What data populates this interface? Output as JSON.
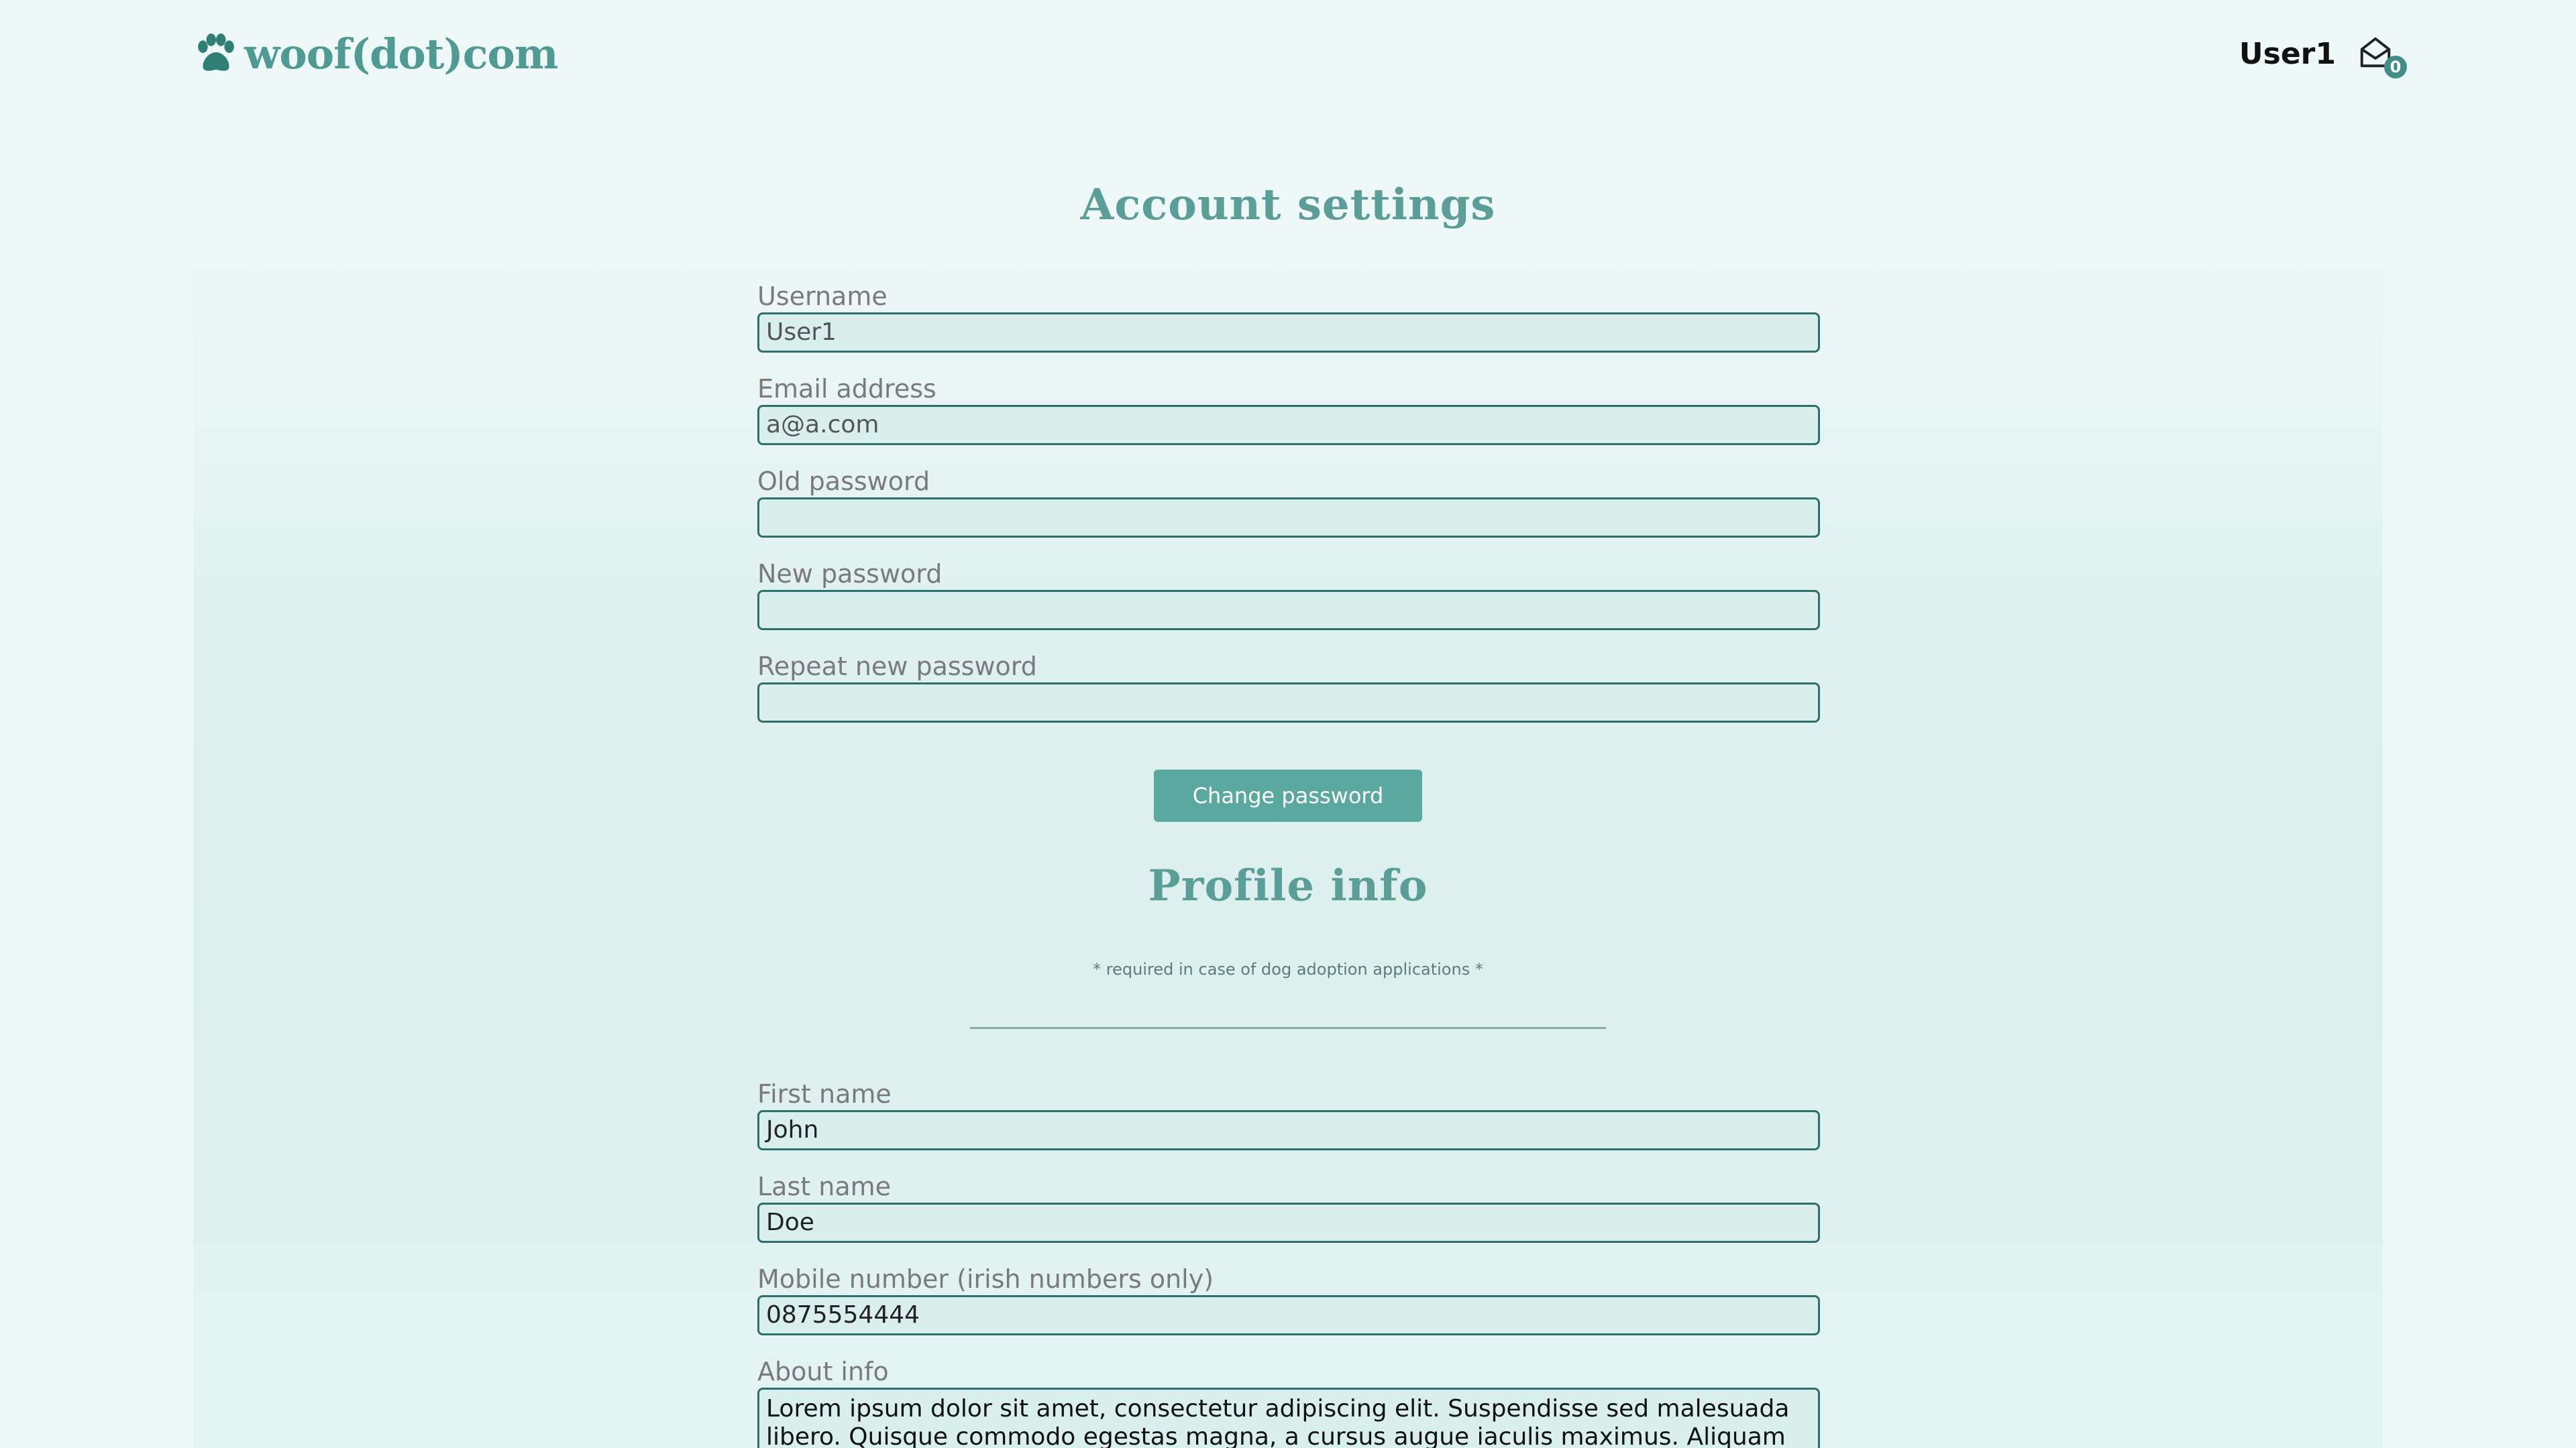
{
  "header": {
    "logo_text": "woof(dot)com",
    "username": "User1",
    "mail_count": "0"
  },
  "account": {
    "title": "Account settings",
    "username": {
      "label": "Username",
      "value": "User1"
    },
    "email": {
      "label": "Email address",
      "value": "a@a.com"
    },
    "old_password": {
      "label": "Old password",
      "value": ""
    },
    "new_password": {
      "label": "New password",
      "value": ""
    },
    "repeat_password": {
      "label": "Repeat new password",
      "value": ""
    },
    "change_password_label": "Change password"
  },
  "profile": {
    "title": "Profile info",
    "note": "* required in case of dog adoption applications *",
    "first_name": {
      "label": "First name",
      "value": "John"
    },
    "last_name": {
      "label": "Last name",
      "value": "Doe"
    },
    "mobile": {
      "label": "Mobile number (irish numbers only)",
      "value": "0875554444"
    },
    "about": {
      "label": "About info",
      "value": "Lorem ipsum dolor sit amet, consectetur adipiscing elit. Suspendisse sed malesuada libero. Quisque commodo egestas magna, a cursus augue iaculis maximus. Aliquam ac molestie nibh."
    }
  },
  "colors": {
    "accent": "#5aa8a0",
    "field_border": "#2f6f69",
    "field_bg": "#d8efec",
    "background": "#eef8f7"
  }
}
